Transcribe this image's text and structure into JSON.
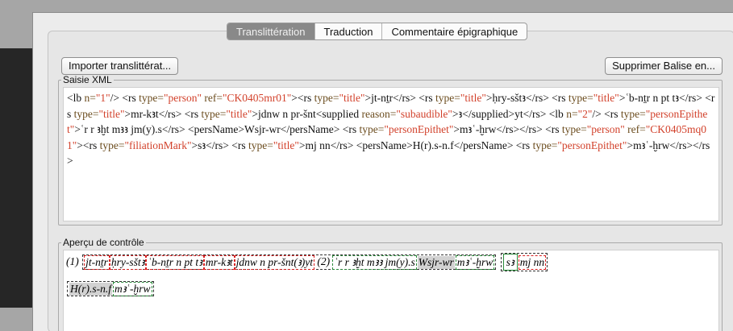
{
  "tabs": [
    {
      "label": "Translittération",
      "active": true
    },
    {
      "label": "Traduction",
      "active": false
    },
    {
      "label": "Commentaire épigraphique",
      "active": false
    }
  ],
  "buttons": {
    "import": "Importer translittérat...",
    "remove": "Supprimer Balise en..."
  },
  "xml_panel": {
    "legend": "Saisie XML",
    "tokens": [
      {
        "t": "tag",
        "v": "<lb "
      },
      {
        "t": "attr",
        "v": "n="
      },
      {
        "t": "str",
        "v": "\"1\""
      },
      {
        "t": "tag",
        "v": "/> <rs "
      },
      {
        "t": "attr",
        "v": "type="
      },
      {
        "t": "str",
        "v": "\"person\""
      },
      {
        "t": "tag",
        "v": " "
      },
      {
        "t": "attr",
        "v": "ref="
      },
      {
        "t": "str",
        "v": "\"CK0405mr01\""
      },
      {
        "t": "tag",
        "v": "><rs "
      },
      {
        "t": "attr",
        "v": "type="
      },
      {
        "t": "str",
        "v": "\"title\""
      },
      {
        "t": "tag",
        "v": ">"
      },
      {
        "t": "txt",
        "v": "jt-nṯr"
      },
      {
        "t": "tag",
        "v": "</rs> <rs "
      },
      {
        "t": "attr",
        "v": "type="
      },
      {
        "t": "str",
        "v": "\"title\""
      },
      {
        "t": "tag",
        "v": ">"
      },
      {
        "t": "txt",
        "v": "ḥry-sštꜣ"
      },
      {
        "t": "tag",
        "v": "</rs> <rs "
      },
      {
        "t": "attr",
        "v": "type="
      },
      {
        "t": "str",
        "v": "\"title\""
      },
      {
        "t": "tag",
        "v": ">"
      },
      {
        "t": "txt",
        "v": "ʿb-nṯr n pt tꜣ"
      },
      {
        "t": "tag",
        "v": "</rs> <rs "
      },
      {
        "t": "attr",
        "v": "type="
      },
      {
        "t": "str",
        "v": "\"title\""
      },
      {
        "t": "tag",
        "v": ">"
      },
      {
        "t": "txt",
        "v": "mr-kꜣt"
      },
      {
        "t": "tag",
        "v": "</rs> <rs "
      },
      {
        "t": "attr",
        "v": "type="
      },
      {
        "t": "str",
        "v": "\"title\""
      },
      {
        "t": "tag",
        "v": ">"
      },
      {
        "t": "txt",
        "v": "jdnw n pr-šnt"
      },
      {
        "t": "tag",
        "v": "<supplied "
      },
      {
        "t": "attr",
        "v": "reason="
      },
      {
        "t": "str",
        "v": "\"subaudible\""
      },
      {
        "t": "tag",
        "v": ">"
      },
      {
        "t": "txt",
        "v": "ꜣ"
      },
      {
        "t": "tag",
        "v": "</supplied>"
      },
      {
        "t": "txt",
        "v": "yt"
      },
      {
        "t": "tag",
        "v": "</rs> <lb "
      },
      {
        "t": "attr",
        "v": "n="
      },
      {
        "t": "str",
        "v": "\"2\""
      },
      {
        "t": "tag",
        "v": "/> <rs "
      },
      {
        "t": "attr",
        "v": "type="
      },
      {
        "t": "str",
        "v": "\"personEpithet\""
      },
      {
        "t": "tag",
        "v": ">"
      },
      {
        "t": "txt",
        "v": "ʿr r ꜣḫt mꜣꜣ jm(y).s"
      },
      {
        "t": "tag",
        "v": "</rs> <persName>"
      },
      {
        "t": "txt",
        "v": "Wsjr-wr"
      },
      {
        "t": "tag",
        "v": "</persName> <rs "
      },
      {
        "t": "attr",
        "v": "type="
      },
      {
        "t": "str",
        "v": "\"personEpithet\""
      },
      {
        "t": "tag",
        "v": ">"
      },
      {
        "t": "txt",
        "v": "mꜣʿ-ḫrw"
      },
      {
        "t": "tag",
        "v": "</rs></rs> <rs "
      },
      {
        "t": "attr",
        "v": "type="
      },
      {
        "t": "str",
        "v": "\"person\""
      },
      {
        "t": "tag",
        "v": " "
      },
      {
        "t": "attr",
        "v": "ref="
      },
      {
        "t": "str",
        "v": "\"CK0405mq01\""
      },
      {
        "t": "tag",
        "v": "><rs "
      },
      {
        "t": "attr",
        "v": "type="
      },
      {
        "t": "str",
        "v": "\"filiationMark\""
      },
      {
        "t": "tag",
        "v": ">"
      },
      {
        "t": "txt",
        "v": "sꜣ"
      },
      {
        "t": "tag",
        "v": "</rs> <rs "
      },
      {
        "t": "attr",
        "v": "type="
      },
      {
        "t": "str",
        "v": "\"title\""
      },
      {
        "t": "tag",
        "v": ">"
      },
      {
        "t": "txt",
        "v": "mj nn"
      },
      {
        "t": "tag",
        "v": "</rs> <persName>"
      },
      {
        "t": "txt",
        "v": "H(r).s-n.f"
      },
      {
        "t": "tag",
        "v": "</persName> <rs "
      },
      {
        "t": "attr",
        "v": "type="
      },
      {
        "t": "str",
        "v": "\"personEpithet\""
      },
      {
        "t": "tag",
        "v": ">"
      },
      {
        "t": "txt",
        "v": "mꜣʿ-ḫrw"
      },
      {
        "t": "tag",
        "v": "</rs></rs>"
      }
    ]
  },
  "preview_panel": {
    "legend": "Aperçu de contrôle",
    "line1_marker": "(1)",
    "line2_marker": "(2)",
    "titles_1": [
      "jt-nṯr",
      "ḥry-sštꜣ",
      "ʿb-nṯr n pt tꜣ",
      "mr-kꜣt",
      "jdnw n pr-šnt(ꜣ)yt"
    ],
    "epithet_1": "ʿr r ꜣḫt mꜣꜣ jm(y).s",
    "name_1": "Wsjr-wr",
    "epithet_2": "mꜣʿ-ḫrw",
    "filiation": "sꜣ",
    "title_2": "mj nn",
    "name_2": "H(r).s-n.f",
    "epithet_3": "mꜣʿ-ḫrw"
  }
}
